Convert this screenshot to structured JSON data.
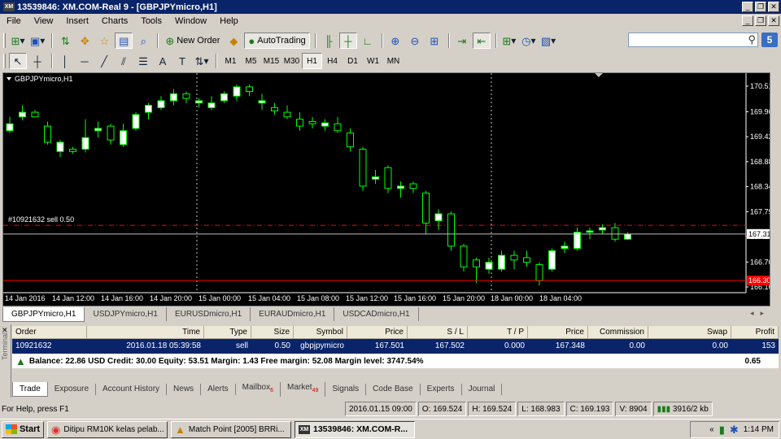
{
  "window": {
    "title": "13539846: XM.COM-Real 9 - [GBPJPYmicro,H1]",
    "logo_text": "XM"
  },
  "menu": [
    "File",
    "View",
    "Insert",
    "Charts",
    "Tools",
    "Window",
    "Help"
  ],
  "toolbar": {
    "new_order_label": "New Order",
    "autotrading_label": "AutoTrading"
  },
  "timeframes": [
    "M1",
    "M5",
    "M15",
    "M30",
    "H1",
    "H4",
    "D1",
    "W1",
    "MN"
  ],
  "active_timeframe": "H1",
  "chart_data": {
    "type": "candlestick",
    "title": "GBPJPYmicro,H1",
    "order_label": "#10921632 sell 0.50",
    "colors": {
      "background": "#000000",
      "bull": "#ffffff",
      "bear": "#000000",
      "outline": "#00ff00",
      "bid_line": "#c0c0c0",
      "ask_line": "#ff0000",
      "order_line": "#ff0000"
    },
    "y_ticks": [
      "170.515",
      "169.960",
      "169.420",
      "168.880",
      "168.340",
      "167.795",
      "167.255",
      "166.705",
      "166.165"
    ],
    "x_ticks": [
      "14 Jan 2016",
      "14 Jan 12:00",
      "14 Jan 16:00",
      "14 Jan 20:00",
      "15 Jan 00:00",
      "15 Jan 04:00",
      "15 Jan 08:00",
      "15 Jan 12:00",
      "15 Jan 16:00",
      "15 Jan 20:00",
      "18 Jan 00:00",
      "18 Jan 04:00"
    ],
    "bid_price": "167.313",
    "ask_price": "166.306",
    "order_price": 167.501,
    "candles": [
      [
        169.55,
        169.85,
        169.7,
        169.5
      ],
      [
        169.85,
        170.1,
        169.95,
        169.78
      ],
      [
        169.95,
        170.0,
        169.85,
        169.85
      ],
      [
        169.65,
        169.75,
        169.3,
        169.25
      ],
      [
        169.1,
        169.35,
        169.3,
        168.98
      ],
      [
        169.15,
        169.2,
        169.1,
        169.05
      ],
      [
        169.15,
        169.8,
        169.4,
        169.08
      ],
      [
        169.55,
        169.75,
        169.6,
        169.4
      ],
      [
        169.65,
        169.7,
        169.35,
        169.25
      ],
      [
        169.25,
        169.7,
        169.55,
        169.2
      ],
      [
        169.6,
        169.95,
        169.9,
        169.55
      ],
      [
        169.95,
        170.15,
        170.1,
        169.8
      ],
      [
        170.05,
        170.3,
        170.2,
        170.0
      ],
      [
        170.2,
        170.45,
        170.35,
        170.1
      ],
      [
        170.35,
        170.4,
        170.25,
        170.15
      ],
      [
        170.15,
        170.25,
        170.2,
        170.05
      ],
      [
        170.05,
        170.3,
        170.15,
        170.0
      ],
      [
        170.2,
        170.4,
        170.35,
        170.15
      ],
      [
        170.3,
        170.55,
        170.5,
        170.2
      ],
      [
        170.5,
        170.55,
        170.4,
        170.3
      ],
      [
        170.15,
        170.35,
        170.2,
        170.0
      ],
      [
        170.05,
        170.15,
        169.98,
        169.9
      ],
      [
        169.95,
        170.1,
        169.85,
        169.8
      ],
      [
        169.8,
        169.95,
        169.65,
        169.55
      ],
      [
        169.75,
        169.85,
        169.7,
        169.6
      ],
      [
        169.65,
        169.8,
        169.72,
        169.55
      ],
      [
        169.7,
        169.85,
        169.55,
        169.5
      ],
      [
        169.5,
        169.6,
        169.2,
        169.1
      ],
      [
        169.15,
        169.2,
        168.35,
        168.25
      ],
      [
        168.5,
        168.7,
        168.55,
        168.4
      ],
      [
        168.75,
        168.8,
        168.3,
        168.2
      ],
      [
        168.3,
        168.45,
        168.35,
        168.1
      ],
      [
        168.4,
        168.45,
        168.3,
        168.2
      ],
      [
        168.2,
        168.25,
        167.55,
        167.3
      ],
      [
        167.6,
        167.85,
        167.75,
        167.4
      ],
      [
        167.75,
        167.8,
        167.05,
        166.95
      ],
      [
        167.05,
        167.1,
        166.6,
        166.5
      ],
      [
        166.75,
        166.8,
        166.6,
        166.25
      ],
      [
        166.55,
        166.8,
        166.7,
        166.45
      ],
      [
        166.55,
        166.95,
        166.85,
        166.5
      ],
      [
        166.85,
        166.95,
        166.75,
        166.55
      ],
      [
        166.8,
        166.95,
        166.7,
        166.6
      ],
      [
        166.65,
        166.7,
        166.3,
        166.2
      ],
      [
        166.55,
        167.0,
        166.95,
        166.5
      ],
      [
        167.0,
        167.15,
        167.05,
        166.9
      ],
      [
        167.0,
        167.45,
        167.35,
        166.95
      ],
      [
        167.35,
        167.45,
        167.38,
        167.2
      ],
      [
        167.4,
        167.52,
        167.45,
        167.3
      ],
      [
        167.45,
        167.55,
        167.2,
        167.15
      ],
      [
        167.2,
        167.35,
        167.31,
        167.18
      ]
    ]
  },
  "chart_tabs": [
    "GBPJPYmicro,H1",
    "USDJPYmicro,H1",
    "EURUSDmicro,H1",
    "EURAUDmicro,H1",
    "USDCADmicro,H1"
  ],
  "terminal": {
    "side_label": "Terminal",
    "columns": [
      "Order",
      "Time",
      "Type",
      "Size",
      "Symbol",
      "Price",
      "S / L",
      "T / P",
      "Price",
      "Commission",
      "Swap",
      "Profit"
    ],
    "row": [
      "10921632",
      "2016.01.18 05:39:58",
      "sell",
      "0.50",
      "gbpjpymicro",
      "167.501",
      "167.502",
      "0.000",
      "167.348",
      "0.00",
      "0.00",
      "153"
    ],
    "balance_text": "Balance: 22.86 USD  Credit: 30.00  Equity: 53.51  Margin: 1.43  Free margin: 52.08  Margin level: 3747.54%",
    "balance_value": "0.65",
    "tabs": [
      "Trade",
      "Exposure",
      "Account History",
      "News",
      "Alerts",
      "Mailbox",
      "Market",
      "Signals",
      "Code Base",
      "Experts",
      "Journal"
    ],
    "mailbox_badge": "6",
    "market_badge": "49"
  },
  "status": {
    "help": "For Help, press F1",
    "datetime": "2016.01.15 09:00",
    "open": "O: 169.524",
    "high": "H: 169.524",
    "low": "L: 168.983",
    "close": "C: 169.193",
    "volume": "V: 8904",
    "traffic": "3916/2 kb"
  },
  "taskbar": {
    "start": "Start",
    "apps": [
      "Ditipu RM10K kelas pelab...",
      "Match Point [2005] BRRi...",
      "13539846: XM.COM-R..."
    ],
    "clock": "1:14 PM"
  },
  "search": {
    "placeholder": ""
  },
  "help_badge": "5"
}
